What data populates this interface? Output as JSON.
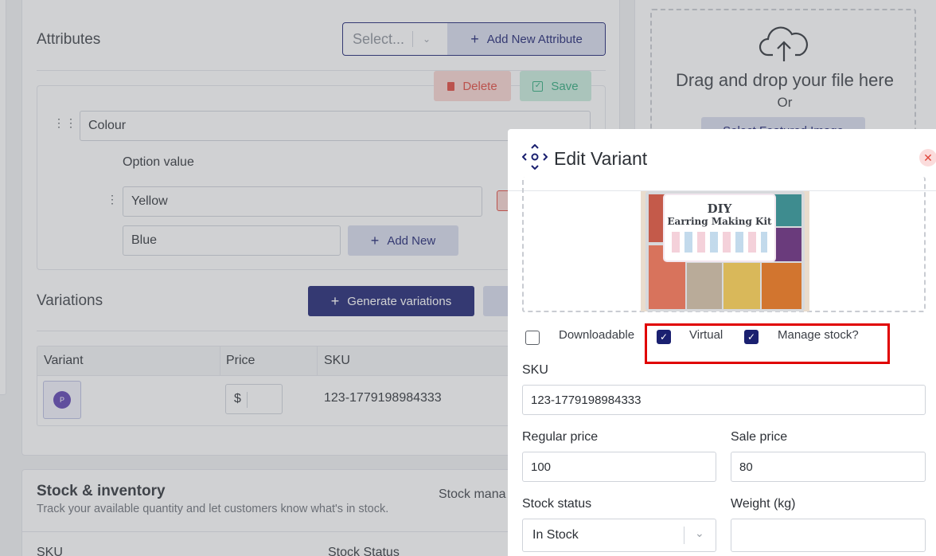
{
  "attributes": {
    "title": "Attributes",
    "select_placeholder": "Select...",
    "add_new_attribute": "Add New Attribute",
    "delete_label": "Delete",
    "save_label": "Save",
    "attribute_name": "Colour",
    "option_value_label": "Option value",
    "options": [
      "Yellow",
      "Blue"
    ],
    "add_new_label": "Add New"
  },
  "variations": {
    "title": "Variations",
    "generate_label": "Generate variations",
    "columns": [
      "Variant",
      "Price",
      "SKU"
    ],
    "row": {
      "avatar_letter": "P",
      "currency": "$",
      "sku": "123-1779198984333"
    }
  },
  "stock": {
    "title": "Stock & inventory",
    "subtitle": "Track your available quantity and let customers know what's in stock.",
    "manage_label_cut": "Stock mana",
    "footer_cols": [
      "SKU",
      "Stock Status"
    ]
  },
  "upload": {
    "drag_text": "Drag and drop your file here",
    "or_text": "Or",
    "select_button": "Select Featured Image"
  },
  "modal": {
    "title": "Edit Variant",
    "product_image_text": [
      "DIY",
      "Earring Making Kit"
    ],
    "checkboxes": [
      {
        "label": "Downloadable",
        "checked": false
      },
      {
        "label": "Virtual",
        "checked": true
      },
      {
        "label": "Manage stock?",
        "checked": true
      }
    ],
    "sku_label": "SKU",
    "sku_value": "123-1779198984333",
    "regular_price_label": "Regular price",
    "regular_price_value": "100",
    "sale_price_label": "Sale price",
    "sale_price_value": "80",
    "stock_status_label": "Stock status",
    "stock_status_value": "In Stock",
    "weight_label": "Weight (kg)",
    "weight_value": ""
  },
  "colors": {
    "primary": "#1a2070",
    "danger": "#e0453a",
    "success": "#2aa87a",
    "highlight": "#e00000"
  }
}
